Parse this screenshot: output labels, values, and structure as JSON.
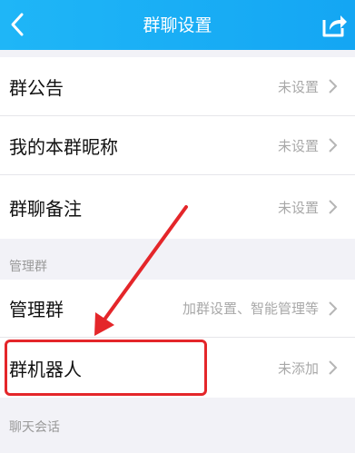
{
  "header": {
    "title": "群聊设置",
    "back_icon": "chevron-left-icon",
    "share_icon": "share-icon"
  },
  "rows": [
    {
      "label": "群公告",
      "value": "未设置"
    },
    {
      "label": "我的本群昵称",
      "value": "未设置"
    },
    {
      "label": "群聊备注",
      "value": "未设置"
    }
  ],
  "sections": {
    "manage_title": "管理群",
    "chat_title": "聊天会话"
  },
  "manage_rows": [
    {
      "label": "管理群",
      "value": "加群设置、智能管理等"
    },
    {
      "label": "群机器人",
      "value": "未添加"
    }
  ],
  "colors": {
    "header": "#1fb6f7",
    "background": "#f2f2f7",
    "annotation": "#e4262a"
  }
}
